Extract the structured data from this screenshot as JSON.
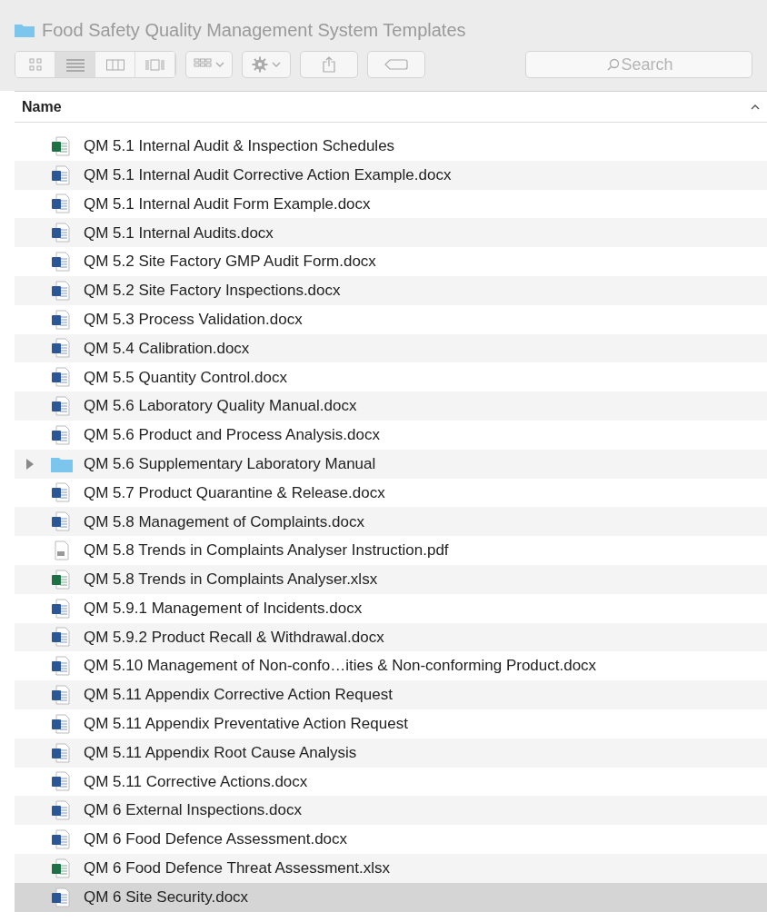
{
  "window": {
    "title": "Food Safety Quality Management System Templates"
  },
  "toolbar": {
    "view_modes": [
      {
        "selected": false
      },
      {
        "selected": true
      },
      {
        "selected": false
      },
      {
        "selected": false
      }
    ],
    "search": {
      "placeholder": "Search"
    }
  },
  "columns": [
    {
      "label": "Name",
      "sort_ascending": true
    }
  ],
  "rows": [
    {
      "name": "QM 5.1 Internal Audit & Inspection Schedules",
      "kind": "sheet",
      "selected": false
    },
    {
      "name": "QM 5.1 Internal Audit Corrective Action Example.docx",
      "kind": "doc",
      "selected": false
    },
    {
      "name": "QM 5.1 Internal Audit Form Example.docx",
      "kind": "doc",
      "selected": false
    },
    {
      "name": "QM 5.1 Internal Audits.docx",
      "kind": "doc",
      "selected": false
    },
    {
      "name": "QM 5.2 Site Factory GMP Audit Form.docx",
      "kind": "doc",
      "selected": false
    },
    {
      "name": "QM 5.2 Site Factory Inspections.docx",
      "kind": "doc",
      "selected": false
    },
    {
      "name": "QM 5.3 Process Validation.docx",
      "kind": "doc",
      "selected": false
    },
    {
      "name": "QM 5.4 Calibration.docx",
      "kind": "doc",
      "selected": false
    },
    {
      "name": "QM 5.5 Quantity Control.docx",
      "kind": "doc",
      "selected": false
    },
    {
      "name": "QM 5.6 Laboratory Quality Manual.docx",
      "kind": "doc",
      "selected": false
    },
    {
      "name": "QM 5.6 Product and Process Analysis.docx",
      "kind": "doc",
      "selected": false
    },
    {
      "name": "QM 5.6 Supplementary Laboratory Manual",
      "kind": "folder",
      "expanded": false,
      "selected": false
    },
    {
      "name": "QM 5.7 Product Quarantine & Release.docx",
      "kind": "doc",
      "selected": false
    },
    {
      "name": "QM 5.8 Management of Complaints.docx",
      "kind": "doc",
      "selected": false
    },
    {
      "name": "QM 5.8 Trends in Complaints Analyser Instruction.pdf",
      "kind": "pdf",
      "selected": false
    },
    {
      "name": "QM 5.8 Trends in Complaints Analyser.xlsx",
      "kind": "sheet",
      "selected": false
    },
    {
      "name": "QM 5.9.1 Management of Incidents.docx",
      "kind": "doc",
      "selected": false
    },
    {
      "name": "QM 5.9.2 Product Recall & Withdrawal.docx",
      "kind": "doc",
      "selected": false
    },
    {
      "name": "QM 5.10 Management of Non-confo…ities & Non-conforming Product.docx",
      "kind": "doc",
      "selected": false
    },
    {
      "name": "QM 5.11 Appendix Corrective Action Request",
      "kind": "doc",
      "selected": false
    },
    {
      "name": "QM 5.11 Appendix Preventative Action Request",
      "kind": "doc",
      "selected": false
    },
    {
      "name": "QM 5.11 Appendix Root Cause Analysis",
      "kind": "doc",
      "selected": false
    },
    {
      "name": "QM 5.11 Corrective Actions.docx",
      "kind": "doc",
      "selected": false
    },
    {
      "name": "QM 6 External Inspections.docx",
      "kind": "doc",
      "selected": false
    },
    {
      "name": "QM 6 Food Defence Assessment.docx",
      "kind": "doc",
      "selected": false
    },
    {
      "name": "QM 6 Food Defence Threat Assessment.xlsx",
      "kind": "sheet",
      "selected": false
    },
    {
      "name": "QM 6 Site Security.docx",
      "kind": "doc",
      "selected": true
    }
  ]
}
